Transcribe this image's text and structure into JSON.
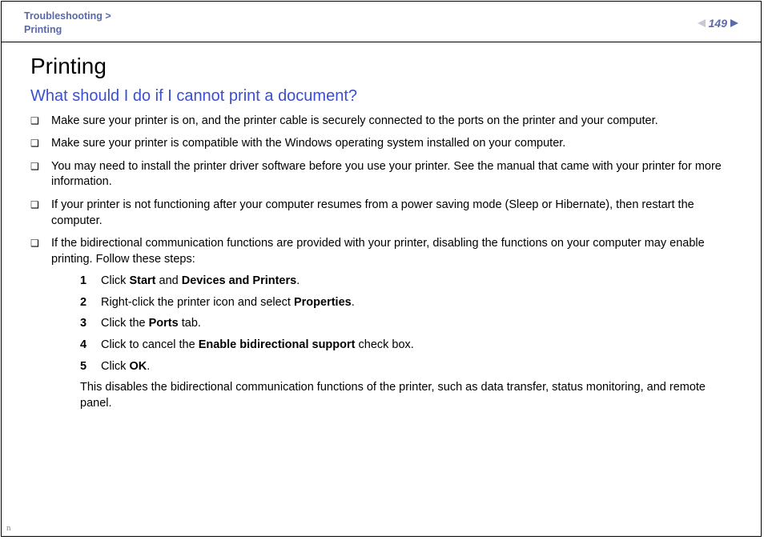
{
  "header": {
    "crumb_parent": "Troubleshooting >",
    "crumb_current": "Printing",
    "page_number": "149"
  },
  "main": {
    "title": "Printing",
    "question": "What should I do if I cannot print a document?",
    "bullets": [
      "Make sure your printer is on, and the printer cable is securely connected to the ports on the printer and your computer.",
      "Make sure your printer is compatible with the Windows operating system installed on your computer.",
      "You may need to install the printer driver software before you use your printer. See the manual that came with your printer for more information.",
      "If your printer is not functioning after your computer resumes from a power saving mode (Sleep or Hibernate), then restart the computer.",
      "If the bidirectional communication functions are provided with your printer, disabling the functions on your computer may enable printing. Follow these steps:"
    ],
    "steps_html": [
      "Click <b>Start</b> and <b>Devices and Printers</b>.",
      "Right-click the printer icon and select <b>Properties</b>.",
      "Click the <b>Ports</b> tab.",
      "Click to cancel the <b>Enable bidirectional support</b> check box.",
      "Click <b>OK</b>."
    ],
    "afternote": "This disables the bidirectional communication functions of the printer, such as data transfer, status monitoring, and remote panel."
  },
  "footer": {
    "n_tag": "n"
  }
}
